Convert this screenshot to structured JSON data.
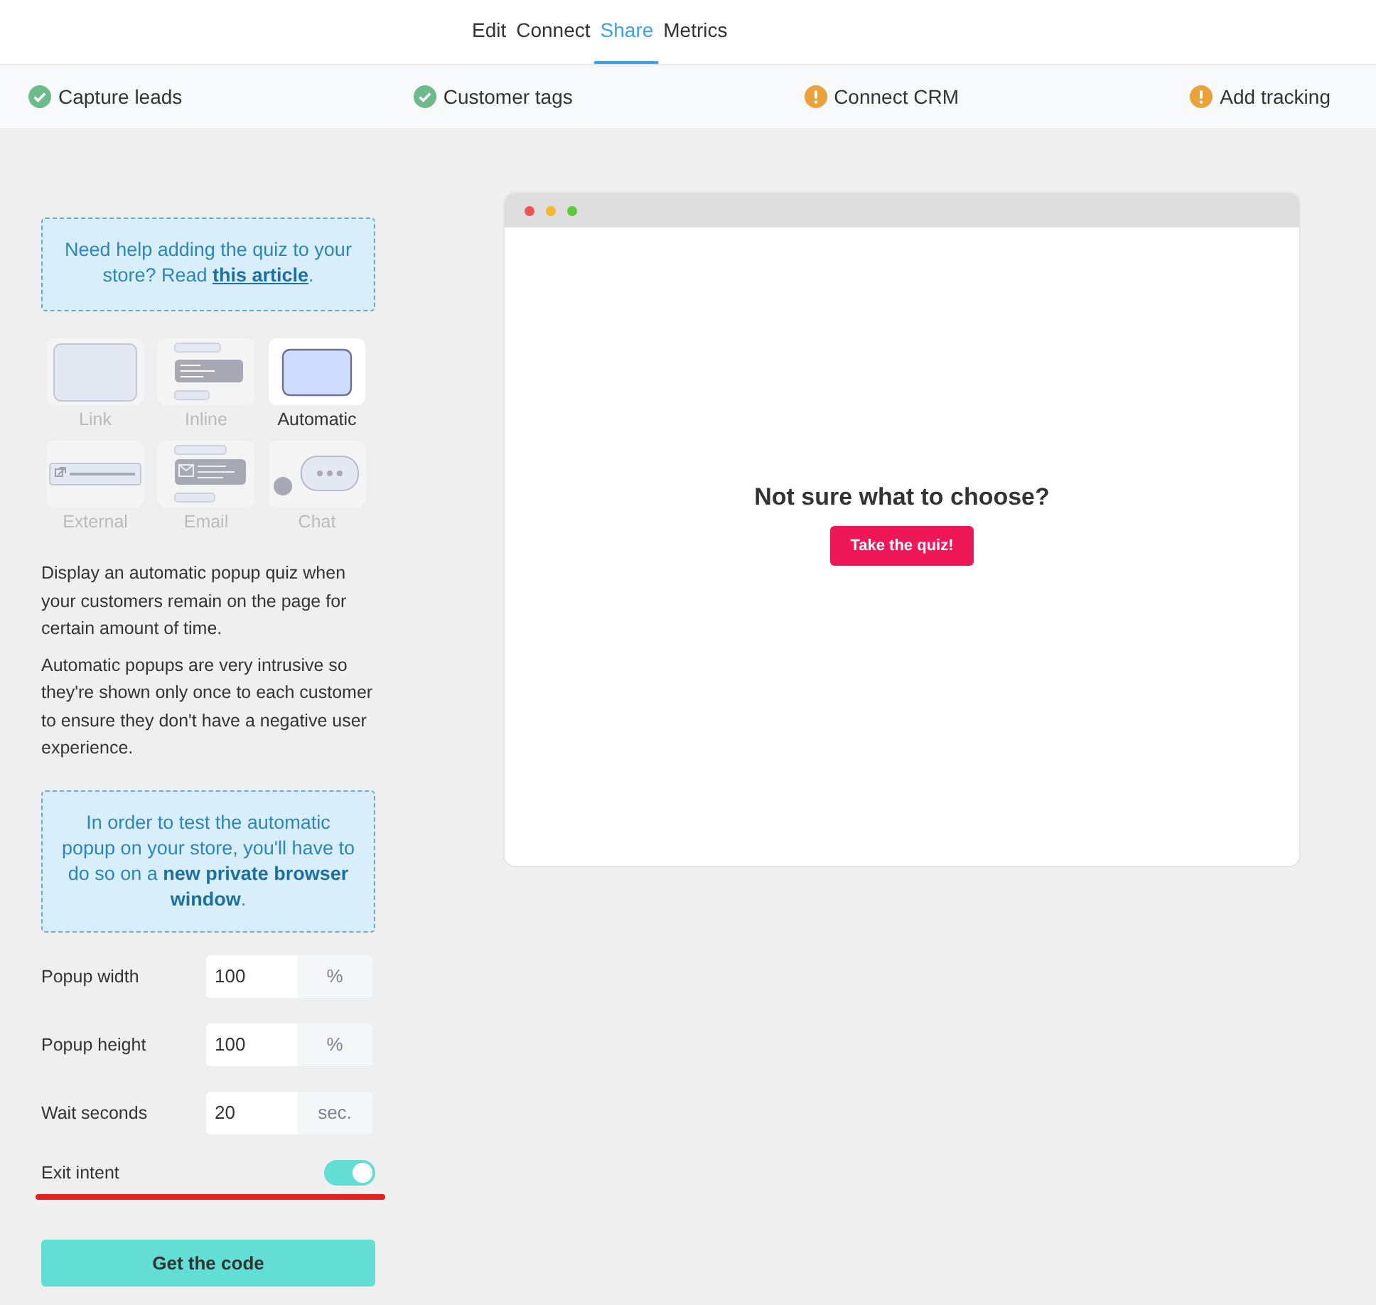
{
  "tabs": [
    {
      "label": "Edit",
      "selected": false
    },
    {
      "label": "Connect",
      "selected": false
    },
    {
      "label": "Share",
      "selected": true
    },
    {
      "label": "Metrics",
      "selected": false
    }
  ],
  "steps": [
    {
      "label": "Capture leads",
      "done": true
    },
    {
      "label": "Customer tags",
      "done": true
    },
    {
      "label": "Connect CRM",
      "done": false
    },
    {
      "label": "Add tracking",
      "done": false
    }
  ],
  "help": {
    "text": "Need help adding the quiz to your store? Read",
    "link": "this article",
    "after": "."
  },
  "embed_types": [
    {
      "label": "Link",
      "kind": "link",
      "selected": false
    },
    {
      "label": "Inline",
      "kind": "inline",
      "selected": false
    },
    {
      "label": "Automatic",
      "kind": "automatic",
      "selected": true
    },
    {
      "label": "External",
      "kind": "external",
      "selected": false
    },
    {
      "label": "Email",
      "kind": "email",
      "selected": false
    },
    {
      "label": "Chat",
      "kind": "chat",
      "selected": false
    }
  ],
  "description": [
    "Display an automatic popup quiz when your customers remain on the page for certain amount of time.",
    "Automatic popups are very intrusive so they're shown only once to each customer to ensure they don't have a negative user experience."
  ],
  "notice": "In order to test the automatic popup on your store, you'll have to do so on a **new private browser window**.",
  "fields": [
    {
      "label": "Popup width",
      "value": "100",
      "unit": "%"
    },
    {
      "label": "Popup height",
      "value": "100",
      "unit": "%"
    },
    {
      "label": "Wait seconds",
      "value": "20",
      "unit": "sec."
    }
  ],
  "exit_intent": {
    "label": "Exit intent",
    "on": true,
    "underlined": true
  },
  "submit": "Get the code",
  "preview": {
    "dots": [
      {
        "color": "#ee5555"
      },
      {
        "color": "#f5b731"
      },
      {
        "color": "#5ecb3e"
      }
    ],
    "heading": "Not sure what to choose?",
    "button": "Take the quiz!"
  }
}
